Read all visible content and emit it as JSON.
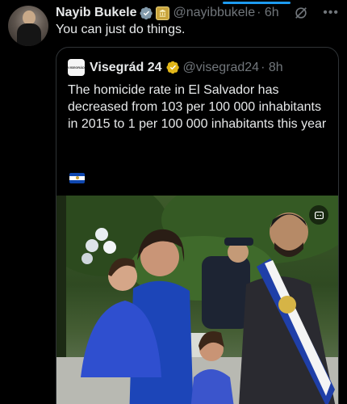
{
  "post": {
    "author_name": "Nayib Bukele",
    "handle": "@nayibbukele",
    "time": "· 6h",
    "text": "You can just do things."
  },
  "quoted": {
    "author_name": "Visegrád 24",
    "logo_text": "VISEGRÁD",
    "handle": "@visegrad24",
    "time": "· 8h",
    "text": "The homicide rate in El Salvador has decreased from 103 per 100 000 inhabitants in 2015 to 1 per 100 000 inhabitants this year"
  },
  "icons": {
    "verified": "verified-badge-icon",
    "affiliate": "government-affiliation-icon",
    "grok": "grok-icon",
    "more": "more-options-icon",
    "flag": "el-salvador-flag-icon",
    "media": "media-settings-icon"
  },
  "colors": {
    "background": "#000000",
    "text": "#e7e9ea",
    "muted": "#71767b",
    "accent": "#1d9bf0",
    "verified_gold": "#e2b719",
    "border": "#2f3336"
  }
}
